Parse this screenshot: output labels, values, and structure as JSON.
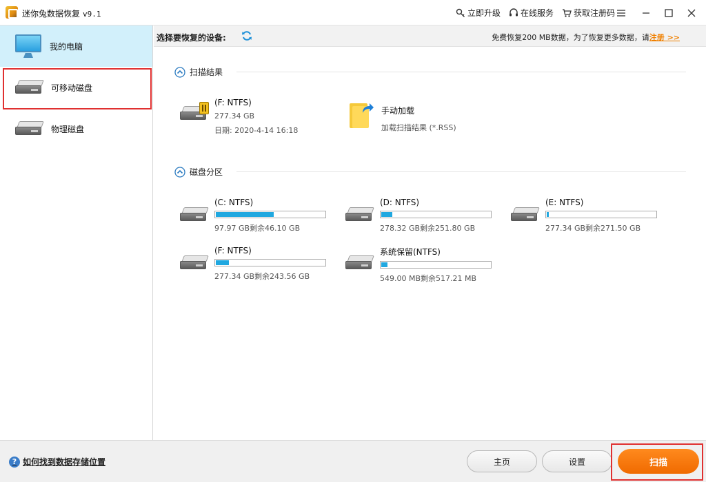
{
  "titlebar": {
    "title": "迷你兔数据恢复",
    "version": "v9.1",
    "links": [
      {
        "label": "立即升级",
        "icon": "key-icon"
      },
      {
        "label": "在线服务",
        "icon": "headset-icon"
      },
      {
        "label": "获取注册码",
        "icon": "cart-icon"
      }
    ]
  },
  "sidebar": {
    "items": [
      {
        "label": "我的电脑",
        "icon": "monitor-icon",
        "active": true
      },
      {
        "label": "可移动磁盘",
        "icon": "removable-disk-icon",
        "highlighted": true
      },
      {
        "label": "物理磁盘",
        "icon": "physical-disk-icon"
      }
    ]
  },
  "header": {
    "select_label": "选择要恢复的设备:",
    "promo_text": "免费恢复200 MB数据，为了恢复更多数据，请",
    "promo_link": "注册 >>"
  },
  "scan_results": {
    "title": "扫描结果",
    "item": {
      "name": "(F: NTFS)",
      "size": "277.34 GB",
      "date": "日期: 2020-4-14 16:18"
    },
    "manual_load": {
      "title": "手动加载",
      "subtitle": "加载扫描结果 (*.RSS)"
    }
  },
  "partitions": {
    "title": "磁盘分区",
    "items": [
      {
        "name": "(C: NTFS)",
        "usage": "97.97 GB剩余46.10 GB",
        "used_fraction": 0.53
      },
      {
        "name": "(D: NTFS)",
        "usage": "278.32 GB剩余251.80 GB",
        "used_fraction": 0.1
      },
      {
        "name": "(E: NTFS)",
        "usage": "277.34 GB剩余271.50 GB",
        "used_fraction": 0.02
      },
      {
        "name": "(F: NTFS)",
        "usage": "277.34 GB剩余243.56 GB",
        "used_fraction": 0.12
      },
      {
        "name": "系统保留(NTFS)",
        "usage": "549.00 MB剩余517.21 MB",
        "used_fraction": 0.06
      }
    ]
  },
  "footer": {
    "help_text": "如何找到数据存储位置",
    "home_label": "主页",
    "settings_label": "设置",
    "scan_label": "扫描"
  },
  "colors": {
    "accent": "#f07800",
    "progress": "#20a8e0",
    "sidebar_active": "#d2f0fb",
    "highlight_box": "#e03030"
  }
}
